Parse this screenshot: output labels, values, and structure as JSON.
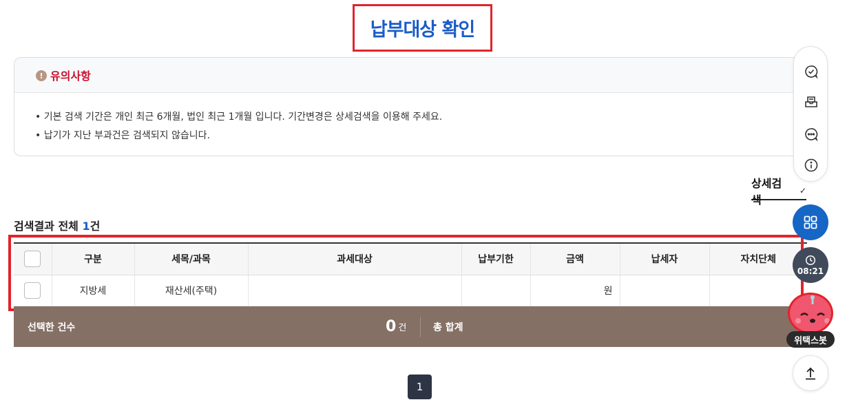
{
  "page": {
    "title": "납부대상 확인"
  },
  "notice": {
    "icon": "exclamation-icon",
    "icon_glyph": "!",
    "title": "유의사항",
    "lines": [
      "기본 검색 기간은 개인 최근 6개월, 법인 최근 1개월 입니다. 기간변경은 상세검색을 이용해 주세요.",
      "납기가 지난 부과건은 검색되지 않습니다."
    ]
  },
  "search": {
    "advanced_label": "상세검색",
    "chevron": "✓"
  },
  "result": {
    "prefix": "검색결과 전체",
    "count": "1",
    "unit": "건"
  },
  "table": {
    "headers": [
      "구분",
      "세목/과목",
      "과세대상",
      "납부기한",
      "금액",
      "납세자",
      "자치단체"
    ],
    "rows": [
      {
        "division": "지방세",
        "tax_item": "재산세(주택)",
        "target": "",
        "due": "",
        "amount": "원",
        "payer": "",
        "authority": ""
      }
    ]
  },
  "summary": {
    "selected_label": "선택한 건수",
    "selected_count": "0",
    "selected_unit": "건",
    "total_label": "총 합계"
  },
  "pagination": {
    "current": "1"
  },
  "side": {
    "timer": "08:21",
    "bot_label": "위택스봇"
  },
  "colors": {
    "accent": "#1a5cc8",
    "highlight": "#e0242b",
    "summary_bar": "#857066",
    "notice_title": "#c8102e"
  }
}
